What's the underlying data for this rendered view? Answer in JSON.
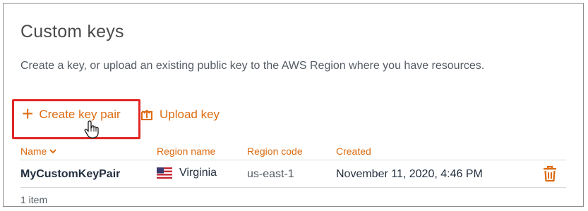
{
  "panel": {
    "title": "Custom keys",
    "description": "Create a key, or upload an existing public key to the AWS Region where you have resources."
  },
  "actions": {
    "create_label": "Create key pair",
    "upload_label": "Upload key"
  },
  "table": {
    "columns": {
      "name": "Name",
      "region_name": "Region name",
      "region_code": "Region code",
      "created": "Created"
    },
    "rows": [
      {
        "name": "MyCustomKeyPair",
        "region_name": "Virginia",
        "region_code": "us-east-1",
        "created": "November 11, 2020, 4:46 PM"
      }
    ],
    "item_count": "1 item"
  },
  "colors": {
    "accent": "#dd6b10",
    "highlight": "#e02626",
    "text": "#232f3e",
    "muted": "#545b64"
  },
  "icons": {
    "create": "plus-icon",
    "upload": "upload-icon",
    "sort": "chevron-down-icon",
    "flag": "us-flag-icon",
    "delete": "trash-icon",
    "cursor": "hand-pointer-icon"
  }
}
